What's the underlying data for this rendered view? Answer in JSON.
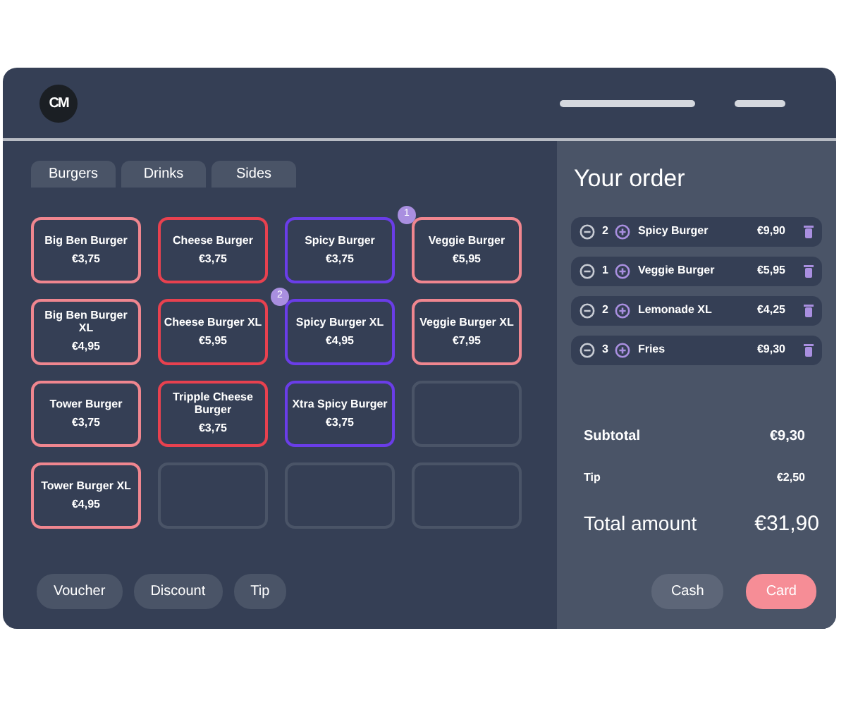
{
  "logo": {
    "text": "CM"
  },
  "tabs": [
    {
      "label": "Burgers"
    },
    {
      "label": "Drinks"
    },
    {
      "label": "Sides"
    }
  ],
  "products": [
    {
      "kind": "item",
      "name": "Big Ben Burger",
      "price": "€3,75",
      "color": "#f0868f"
    },
    {
      "kind": "item",
      "name": "Cheese Burger",
      "price": "€3,75",
      "color": "#e8414f"
    },
    {
      "kind": "item",
      "name": "Spicy Burger",
      "price": "€3,75",
      "color": "#6a3de8"
    },
    {
      "kind": "item",
      "name": "Veggie Burger",
      "price": "€5,95",
      "color": "#f0868f",
      "badge": "1"
    },
    {
      "kind": "item",
      "name": "Big Ben Burger XL",
      "price": "€4,95",
      "color": "#f0868f"
    },
    {
      "kind": "item",
      "name": "Cheese Burger XL",
      "price": "€5,95",
      "color": "#e8414f"
    },
    {
      "kind": "item",
      "name": "Spicy Burger XL",
      "price": "€4,95",
      "color": "#6a3de8",
      "badge": "2"
    },
    {
      "kind": "item",
      "name": "Veggie Burger XL",
      "price": "€7,95",
      "color": "#f0868f"
    },
    {
      "kind": "item",
      "name": "Tower Burger",
      "price": "€3,75",
      "color": "#f0868f"
    },
    {
      "kind": "item",
      "name": "Tripple Cheese Burger",
      "price": "€3,75",
      "color": "#e8414f"
    },
    {
      "kind": "item",
      "name": "Xtra Spicy Burger",
      "price": "€3,75",
      "color": "#6a3de8"
    },
    {
      "kind": "empty"
    },
    {
      "kind": "item",
      "name": "Tower Burger XL",
      "price": "€4,95",
      "color": "#f0868f"
    },
    {
      "kind": "empty"
    },
    {
      "kind": "empty"
    },
    {
      "kind": "empty"
    }
  ],
  "actions": [
    "Voucher",
    "Discount",
    "Tip"
  ],
  "order": {
    "title": "Your order",
    "lines": [
      {
        "qty": "2",
        "name": "Spicy Burger",
        "price": "€9,90"
      },
      {
        "qty": "1",
        "name": "Veggie Burger",
        "price": "€5,95"
      },
      {
        "qty": "2",
        "name": "Lemonade XL",
        "price": "€4,25"
      },
      {
        "qty": "3",
        "name": "Fries",
        "price": "€9,30"
      }
    ],
    "subtotal": {
      "label": "Subtotal",
      "value": "€9,30"
    },
    "tip": {
      "label": "Tip",
      "value": "€2,50"
    },
    "total": {
      "label": "Total amount",
      "value": "€31,90"
    },
    "payments": [
      {
        "label": "Cash",
        "kind": "secondary"
      },
      {
        "label": "Card",
        "kind": "primary"
      }
    ]
  }
}
